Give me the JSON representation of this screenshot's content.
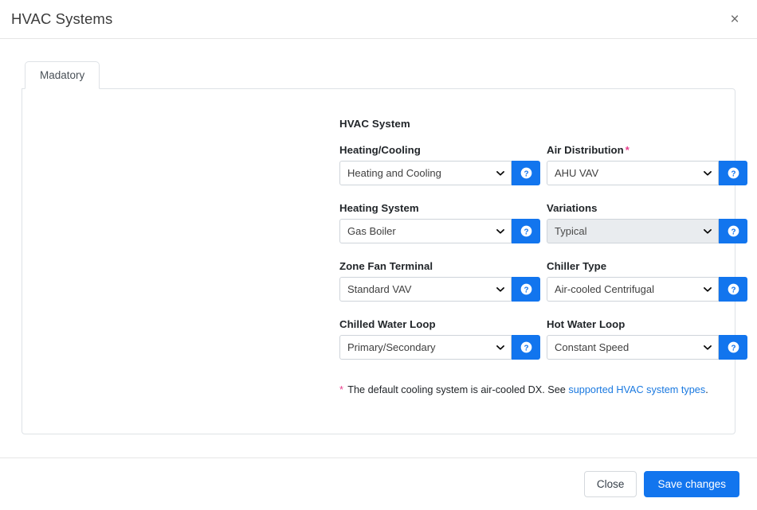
{
  "dialog": {
    "title": "HVAC Systems",
    "close_icon": "close-x-icon",
    "close_label": "×"
  },
  "tabs": [
    {
      "label": "Madatory",
      "active": true
    }
  ],
  "form": {
    "section_title": "HVAC System",
    "help_icon": "question-circle-icon",
    "required_marker": "*",
    "fields": [
      {
        "label": "Heating/Cooling",
        "value": "Heating and Cooling",
        "required": false,
        "disabled": false,
        "name": "heating-cooling"
      },
      {
        "label": "Air Distribution",
        "value": "AHU VAV",
        "required": true,
        "disabled": false,
        "name": "air-distribution"
      },
      {
        "label": "Heating System",
        "value": "Gas Boiler",
        "required": false,
        "disabled": false,
        "name": "heating-system"
      },
      {
        "label": "Variations",
        "value": "Typical",
        "required": false,
        "disabled": true,
        "name": "variations"
      },
      {
        "label": "Zone Fan Terminal",
        "value": "Standard VAV",
        "required": false,
        "disabled": false,
        "name": "zone-fan-terminal"
      },
      {
        "label": "Chiller Type",
        "value": "Air-cooled Centrifugal",
        "required": false,
        "disabled": false,
        "name": "chiller-type"
      },
      {
        "label": "Chilled Water Loop",
        "value": "Primary/Secondary",
        "required": false,
        "disabled": false,
        "name": "chilled-water-loop"
      },
      {
        "label": "Hot Water Loop",
        "value": "Constant Speed",
        "required": false,
        "disabled": false,
        "name": "hot-water-loop"
      }
    ],
    "footnote": {
      "star": "*",
      "text_before": " The default cooling system is air-cooled DX. See ",
      "link_text": "supported HVAC system types",
      "text_after": "."
    }
  },
  "footer": {
    "close_label": "Close",
    "save_label": "Save changes"
  },
  "colors": {
    "accent_blue": "#1275ee",
    "link_blue": "#1a79e0",
    "required_pink": "#e83e8c",
    "disabled_grey": "#e9ecef",
    "border_grey": "#dee2e6"
  }
}
